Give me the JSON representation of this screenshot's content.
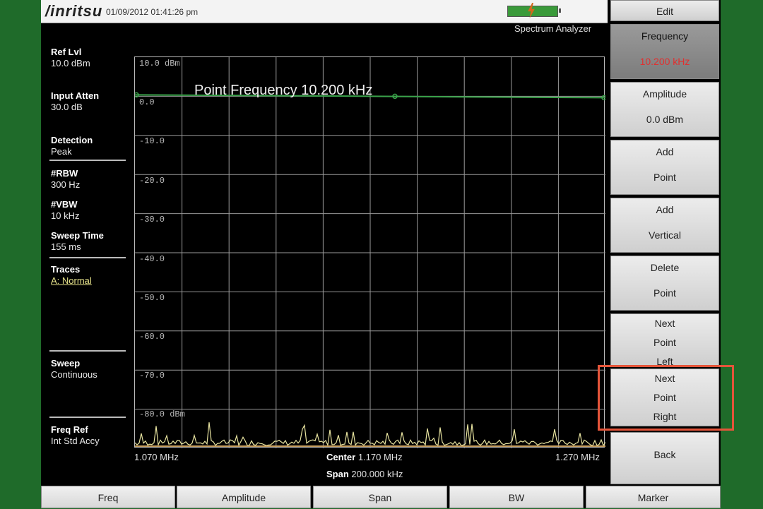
{
  "header": {
    "brand": "/inritsu",
    "datetime": "01/09/2012  01:41:26 pm",
    "mode": "Spectrum Analyzer"
  },
  "left_panel": {
    "ref_lvl": {
      "label": "Ref Lvl",
      "value": "10.0 dBm"
    },
    "input_atten": {
      "label": "Input Atten",
      "value": "30.0 dB"
    },
    "detection": {
      "label": "Detection",
      "value": "Peak"
    },
    "rbw": {
      "label": "#RBW",
      "value": "300 Hz"
    },
    "vbw": {
      "label": "#VBW",
      "value": "10 kHz"
    },
    "sweep_time": {
      "label": "Sweep Time",
      "value": "155 ms"
    },
    "traces": {
      "label": "Traces",
      "value": "A: Normal"
    },
    "sweep": {
      "label": "Sweep",
      "value": "Continuous"
    },
    "freq_ref": {
      "label": "Freq Ref",
      "value": "Int Std Accy"
    }
  },
  "plot": {
    "y_labels": [
      "10.0 dBm",
      "0.0",
      "-10.0",
      "-20.0",
      "-30.0",
      "-40.0",
      "-50.0",
      "-60.0",
      "-70.0",
      "-80.0 dBm"
    ],
    "point_label": "Point Frequency 10.200 kHz",
    "x_start": "1.070 MHz",
    "center_label": "Center",
    "center_value": "1.170 MHz",
    "span_label": "Span",
    "span_value": "200.000 kHz",
    "x_stop": "1.270 MHz"
  },
  "softkeys": {
    "edit": "Edit",
    "frequency": {
      "line1": "Frequency",
      "line2": "10.200 kHz"
    },
    "amplitude": {
      "line1": "Amplitude",
      "line2": "0.0 dBm"
    },
    "add_point": {
      "line1": "Add",
      "line2": "Point"
    },
    "add_vertical": {
      "line1": "Add",
      "line2": "Vertical"
    },
    "delete_point": {
      "line1": "Delete",
      "line2": "Point"
    },
    "next_point_left": {
      "line1": "Next",
      "line2": "Point",
      "line3": "Left"
    },
    "next_point_right": {
      "line1": "Next",
      "line2": "Point",
      "line3": "Right"
    },
    "back": "Back"
  },
  "bottom_menu": [
    "Freq",
    "Amplitude",
    "Span",
    "BW",
    "Marker"
  ],
  "colors": {
    "highlight": "#e4553a",
    "limit_line": "#3aa24a",
    "trace": "#e8e4a0",
    "active_value": "#e03030"
  }
}
